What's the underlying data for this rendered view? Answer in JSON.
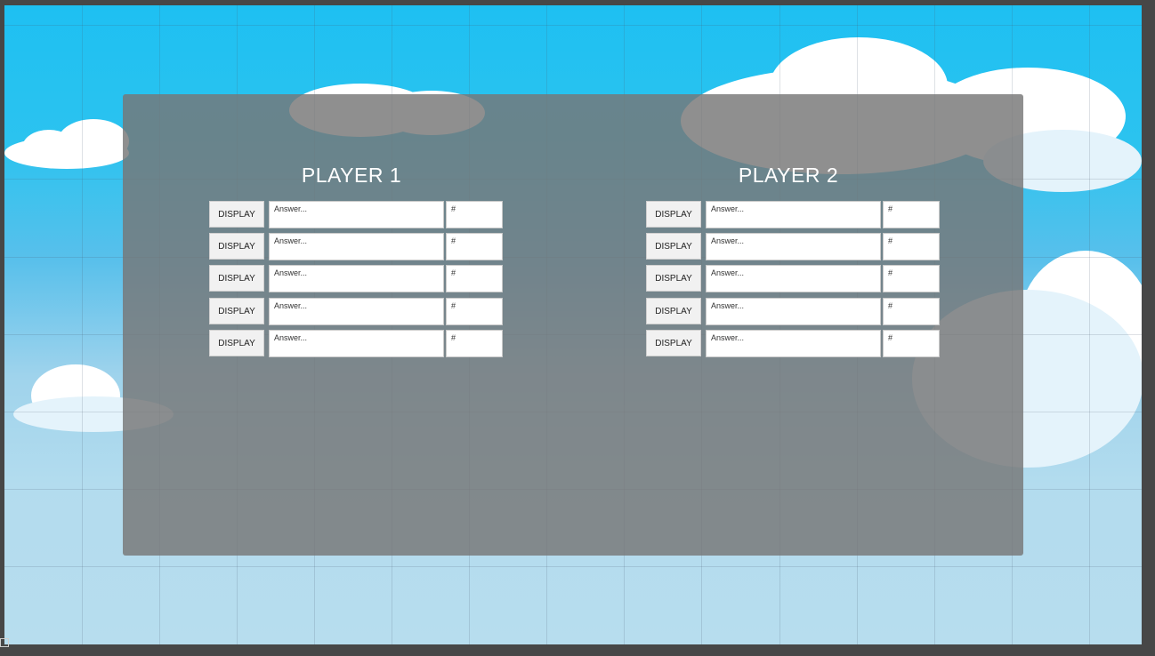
{
  "players": [
    {
      "title": "PLAYER 1",
      "rows": [
        {
          "button": "DISPLAY",
          "answer_placeholder": "Answer...",
          "number_placeholder": "#"
        },
        {
          "button": "DISPLAY",
          "answer_placeholder": "Answer...",
          "number_placeholder": "#"
        },
        {
          "button": "DISPLAY",
          "answer_placeholder": "Answer...",
          "number_placeholder": "#"
        },
        {
          "button": "DISPLAY",
          "answer_placeholder": "Answer...",
          "number_placeholder": "#"
        },
        {
          "button": "DISPLAY",
          "answer_placeholder": "Answer...",
          "number_placeholder": "#"
        }
      ]
    },
    {
      "title": "PLAYER 2",
      "rows": [
        {
          "button": "DISPLAY",
          "answer_placeholder": "Answer...",
          "number_placeholder": "#"
        },
        {
          "button": "DISPLAY",
          "answer_placeholder": "Answer...",
          "number_placeholder": "#"
        },
        {
          "button": "DISPLAY",
          "answer_placeholder": "Answer...",
          "number_placeholder": "#"
        },
        {
          "button": "DISPLAY",
          "answer_placeholder": "Answer...",
          "number_placeholder": "#"
        },
        {
          "button": "DISPLAY",
          "answer_placeholder": "Answer...",
          "number_placeholder": "#"
        }
      ]
    }
  ],
  "colors": {
    "sky_top": "#1ec0f2",
    "sky_bottom": "#b7ddee",
    "panel": "#767676",
    "editor_frame": "#474747"
  }
}
